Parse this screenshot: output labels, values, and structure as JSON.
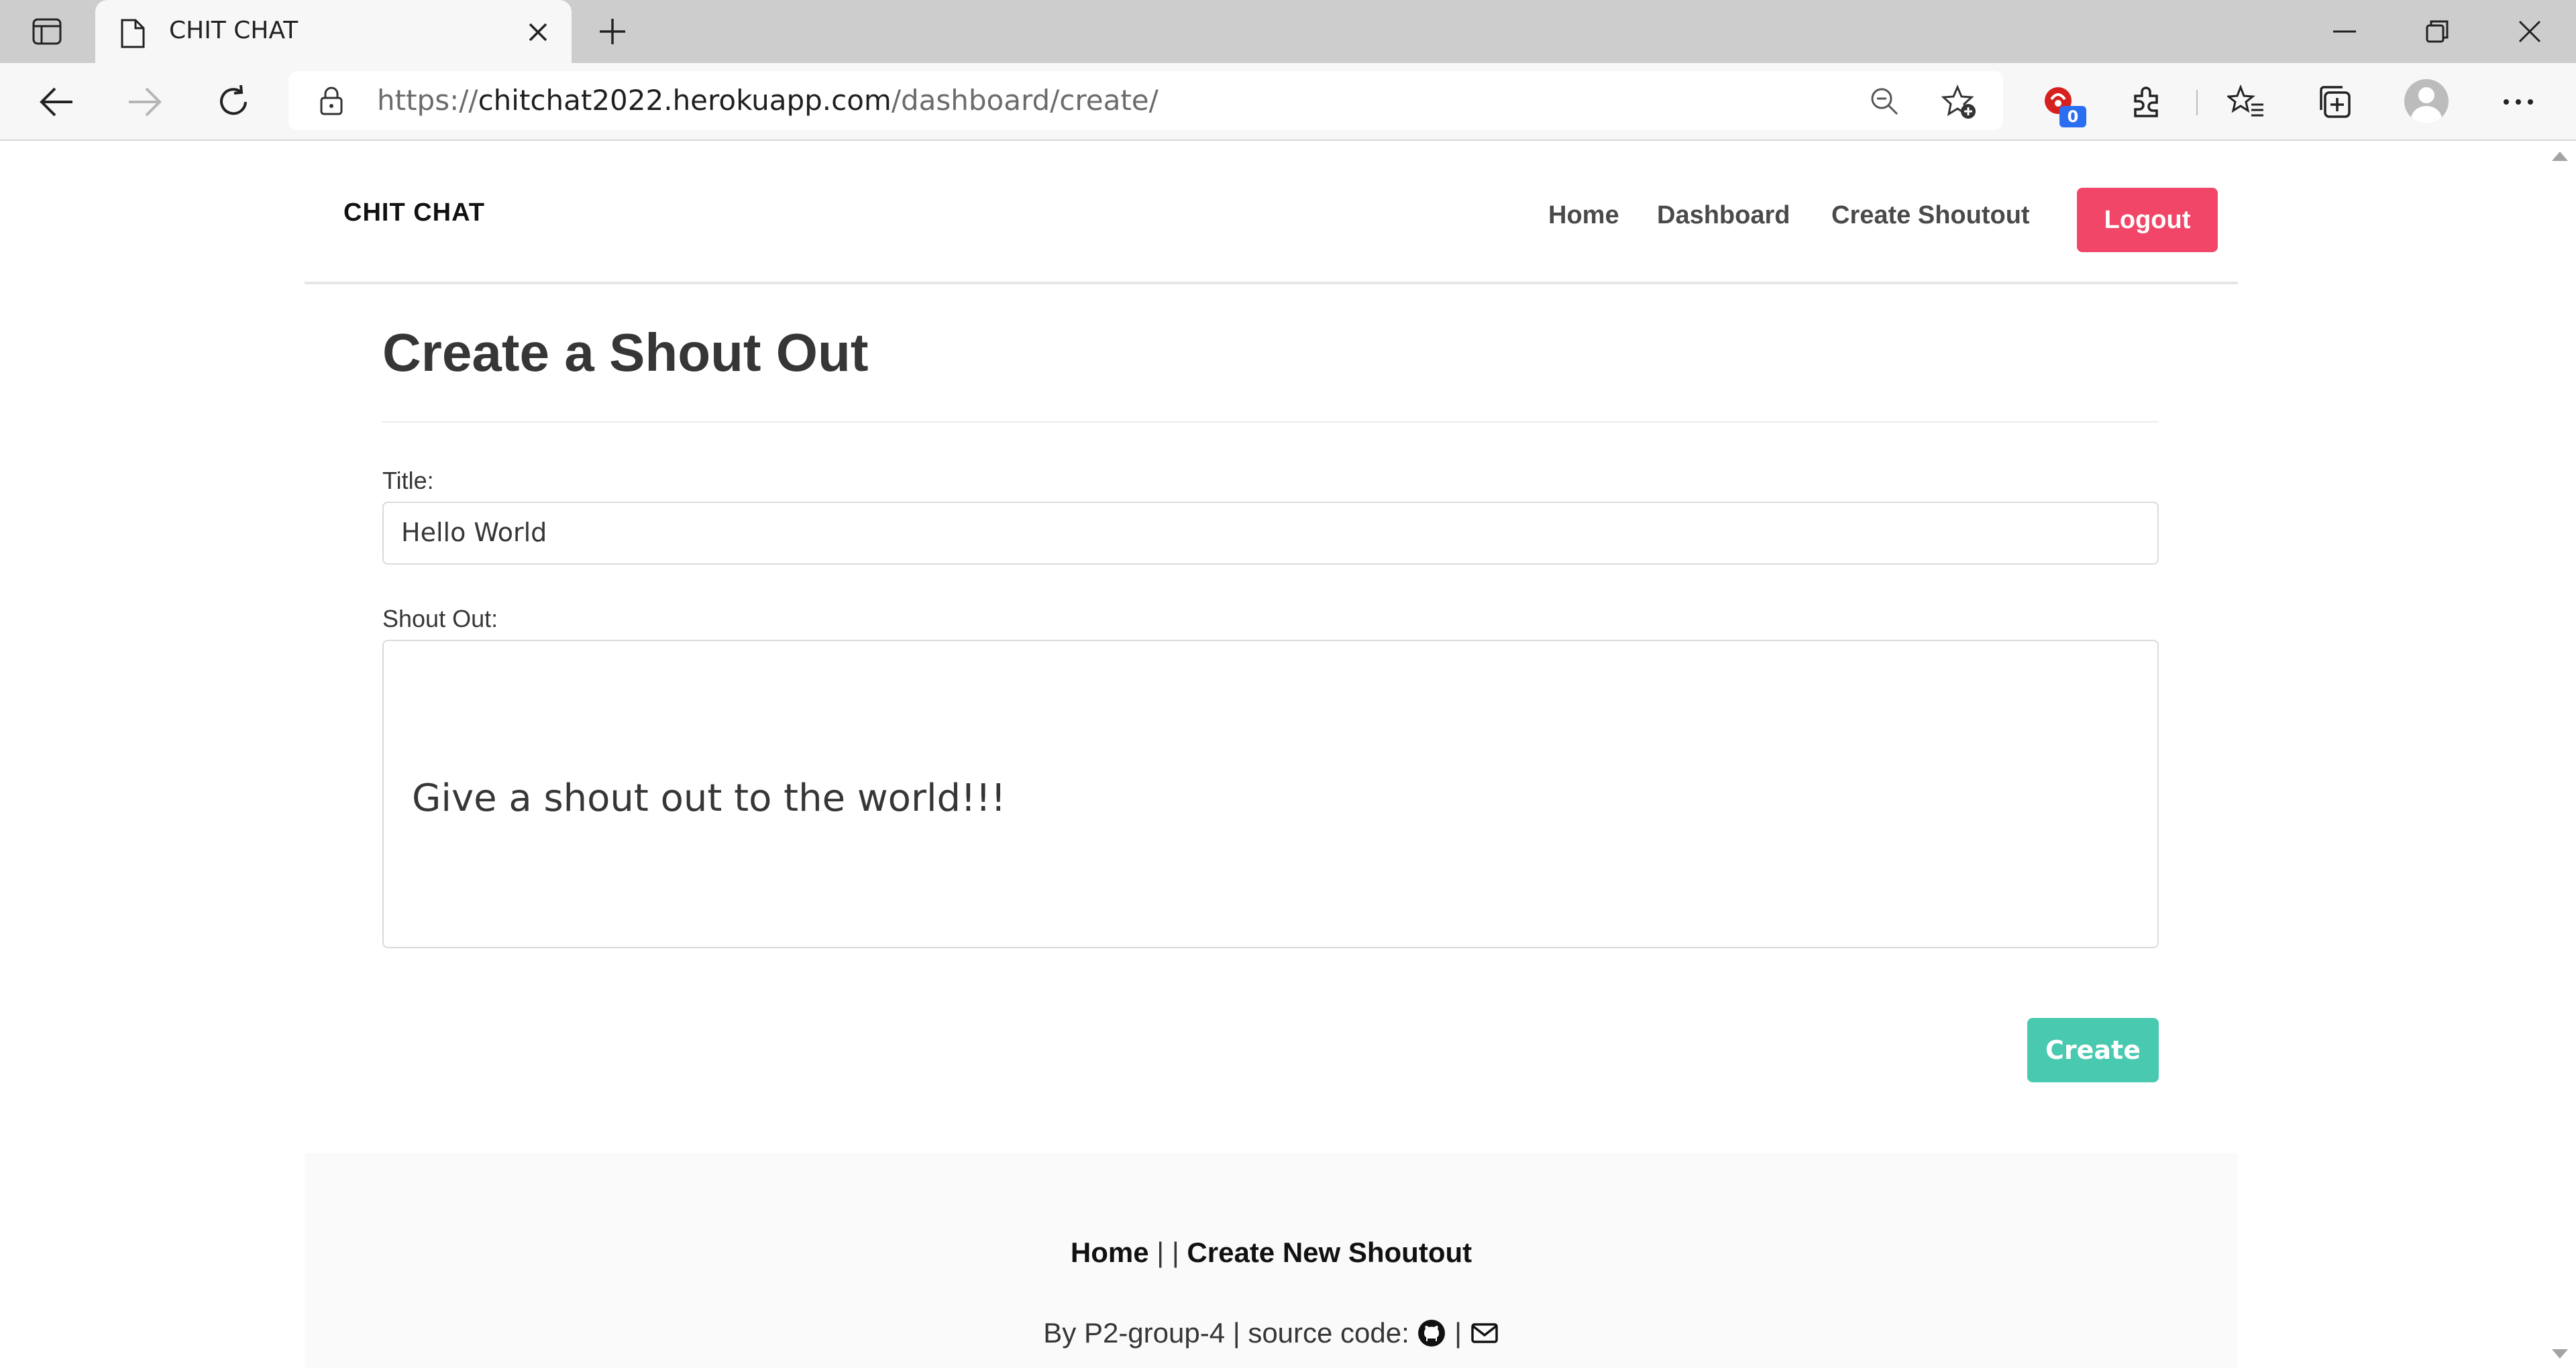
{
  "browser": {
    "tab_title": "CHIT CHAT",
    "url_prefix": "https://",
    "url_host": "chitchat2022.herokuapp.com",
    "url_path": "/dashboard/create/",
    "extension_badge": "0"
  },
  "navbar": {
    "brand": "CHIT CHAT",
    "links": [
      "Home",
      "Dashboard",
      "Create Shoutout"
    ],
    "logout_label": "Logout"
  },
  "form": {
    "heading": "Create a Shout Out",
    "title_label": "Title:",
    "title_value": "Hello World",
    "shoutout_label": "Shout Out:",
    "shoutout_value": "Give a shout out to the world!!!",
    "submit_label": "Create"
  },
  "footer": {
    "links": [
      "Home",
      "Create New Shoutout"
    ],
    "separator": "| |",
    "credit_text": "By P2-group-4 | source code:",
    "icon_separator": "|"
  },
  "colors": {
    "logout_bg": "#f14668",
    "create_bg": "#48c9b0"
  }
}
